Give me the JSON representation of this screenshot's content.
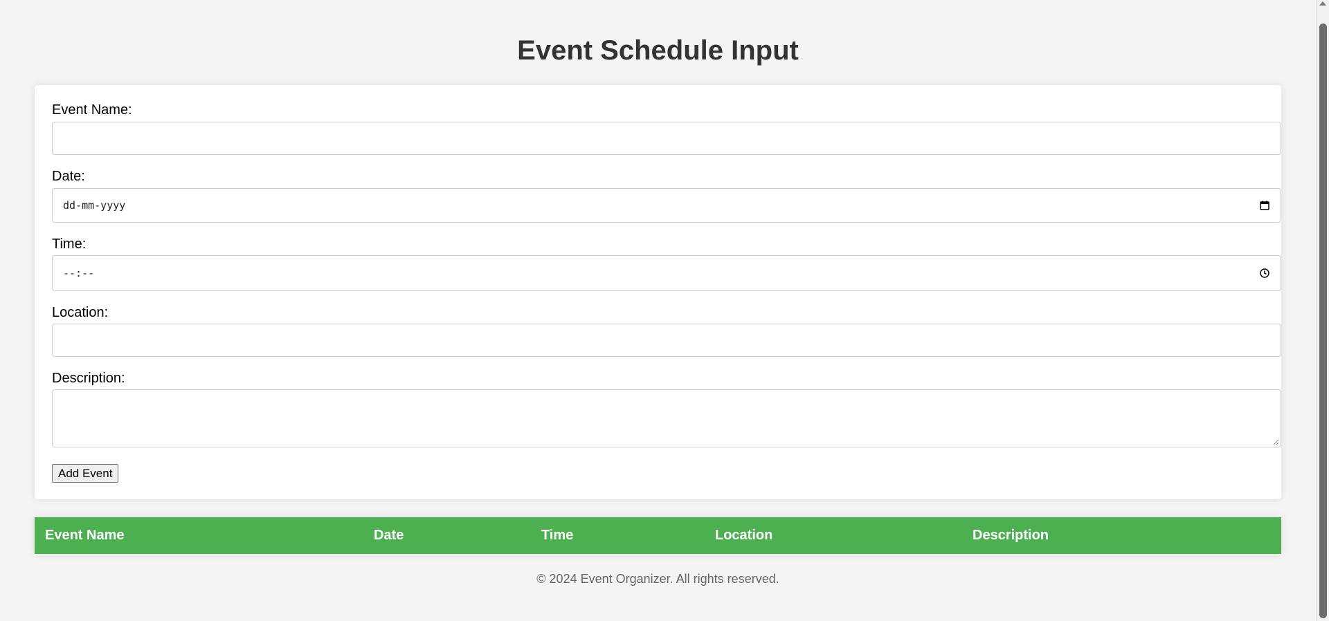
{
  "page": {
    "title": "Event Schedule Input",
    "footer": "© 2024 Event Organizer. All rights reserved."
  },
  "form": {
    "event_name": {
      "label": "Event Name:",
      "value": ""
    },
    "date": {
      "label": "Date:",
      "placeholder": "dd-mm-yyyy",
      "icon": "calendar-icon"
    },
    "time": {
      "label": "Time:",
      "placeholder": "--:--",
      "icon": "clock-icon"
    },
    "location": {
      "label": "Location:",
      "value": ""
    },
    "description": {
      "label": "Description:",
      "value": ""
    },
    "submit_label": "Add Event"
  },
  "table": {
    "columns": [
      "Event Name",
      "Date",
      "Time",
      "Location",
      "Description"
    ],
    "rows": []
  },
  "colors": {
    "header_green": "#4caf50",
    "background": "#f4f4f4",
    "title": "#333333"
  }
}
